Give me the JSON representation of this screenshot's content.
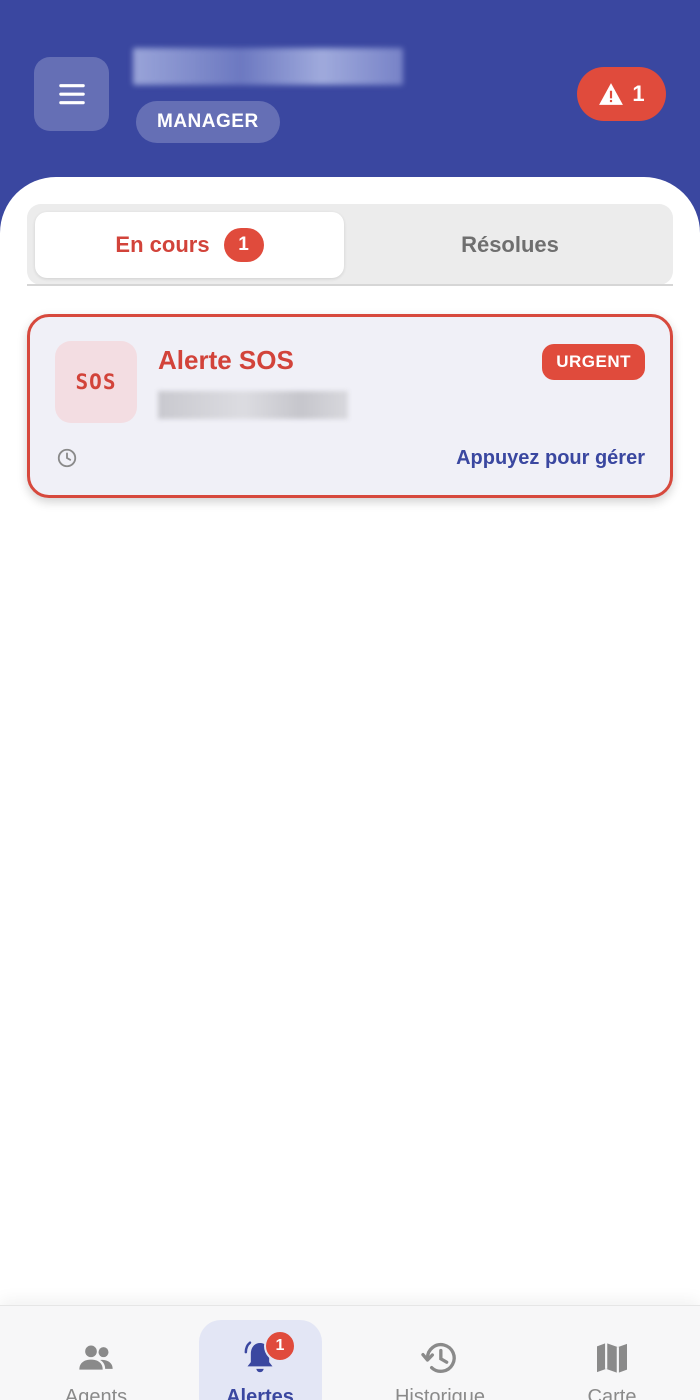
{
  "header": {
    "role_badge": "MANAGER",
    "alert_count": "1",
    "colors": {
      "primary": "#3a47a0",
      "danger": "#e04b3c"
    }
  },
  "tabs": [
    {
      "label": "En cours",
      "count": "1",
      "active": true
    },
    {
      "label": "Résolues",
      "active": false
    }
  ],
  "alert_card": {
    "icon_text": "SOS",
    "title": "Alerte SOS",
    "badge": "URGENT",
    "action_label": "Appuyez pour gérer",
    "icons": {
      "time": "clock-icon"
    }
  },
  "bottom_nav": {
    "items": [
      {
        "label": "Agents",
        "icon": "people-icon"
      },
      {
        "label": "Alertes",
        "icon": "bell-icon",
        "active": true,
        "badge": "1"
      },
      {
        "label": "Historique",
        "icon": "history-icon"
      },
      {
        "label": "Carte",
        "icon": "map-icon"
      }
    ]
  }
}
